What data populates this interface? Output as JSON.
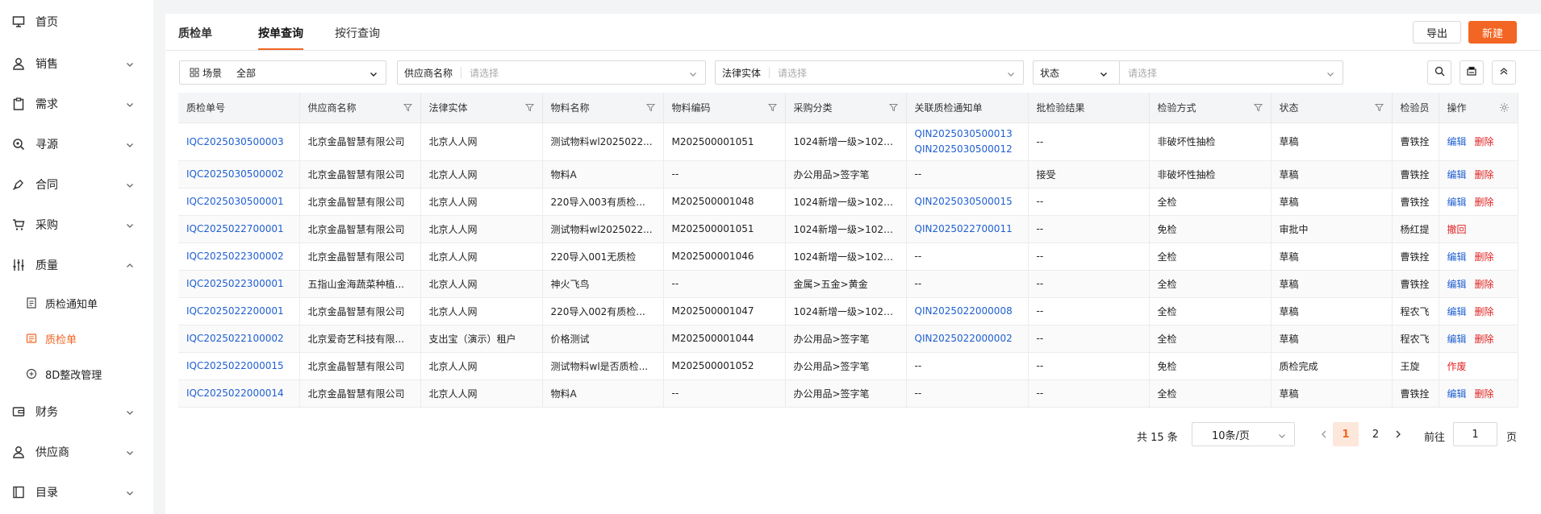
{
  "sidebar": {
    "items": [
      {
        "label": "首页",
        "icon": "monitor-icon",
        "chevron": false
      },
      {
        "label": "销售",
        "icon": "user-icon",
        "chevron": "down"
      },
      {
        "label": "需求",
        "icon": "clipboard-icon",
        "chevron": "down"
      },
      {
        "label": "寻源",
        "icon": "search-source-icon",
        "chevron": "down"
      },
      {
        "label": "合同",
        "icon": "pen-icon",
        "chevron": "down"
      },
      {
        "label": "采购",
        "icon": "cart-icon",
        "chevron": "down"
      },
      {
        "label": "质量",
        "icon": "sliders-icon",
        "chevron": "up"
      }
    ],
    "sub_items": [
      {
        "label": "质检通知单",
        "icon": "doc-icon",
        "active": false
      },
      {
        "label": "质检单",
        "icon": "list-doc-icon",
        "active": true
      },
      {
        "label": "8D整改管理",
        "icon": "8d-icon",
        "active": false
      }
    ],
    "items_after": [
      {
        "label": "财务",
        "icon": "wallet-icon",
        "chevron": "down"
      },
      {
        "label": "供应商",
        "icon": "user-icon",
        "chevron": "down"
      },
      {
        "label": "目录",
        "icon": "book-icon",
        "chevron": "down"
      }
    ]
  },
  "tabs": [
    {
      "label": "质检单"
    },
    {
      "label": "按单查询"
    },
    {
      "label": "按行查询"
    }
  ],
  "toolbar": {
    "export_label": "导出",
    "new_label": "新建"
  },
  "filters": {
    "scene_label": "场景",
    "scene_value": "全部",
    "supplier_label": "供应商名称",
    "supplier_placeholder": "请选择",
    "entity_label": "法律实体",
    "entity_placeholder": "请选择",
    "status_label": "状态",
    "status_placeholder": "请选择"
  },
  "table": {
    "headers": [
      "质检单号",
      "供应商名称",
      "法律实体",
      "物料名称",
      "物料编码",
      "采购分类",
      "关联质检通知单",
      "批检验结果",
      "检验方式",
      "状态",
      "检验员",
      "操作"
    ],
    "rows": [
      {
        "no": "IQC2025030500003",
        "supplier": "北京金晶智慧有限公司",
        "entity": "北京人人网",
        "material": "测试物料wl2025022...",
        "code": "M202500001051",
        "category": "1024新增一级>1024...",
        "notice": [
          "QIN2025030500013",
          "QIN2025030500012"
        ],
        "result": "--",
        "method": "非破坏性抽检",
        "status": "草稿",
        "inspector": "曹铁拴",
        "ops": [
          "编辑",
          "删除"
        ]
      },
      {
        "no": "IQC2025030500002",
        "supplier": "北京金晶智慧有限公司",
        "entity": "北京人人网",
        "material": "物料A",
        "code": "--",
        "category": "办公用品>签字笔",
        "notice": [],
        "notice_text": "--",
        "result": "接受",
        "method": "非破坏性抽检",
        "status": "草稿",
        "inspector": "曹铁拴",
        "ops": [
          "编辑",
          "删除"
        ]
      },
      {
        "no": "IQC2025030500001",
        "supplier": "北京金晶智慧有限公司",
        "entity": "北京人人网",
        "material": "220导入003有质检...",
        "code": "M202500001048",
        "category": "1024新增一级>1024...",
        "notice": [
          "QIN2025030500015"
        ],
        "result": "--",
        "method": "全检",
        "status": "草稿",
        "inspector": "曹铁拴",
        "ops": [
          "编辑",
          "删除"
        ]
      },
      {
        "no": "IQC2025022700001",
        "supplier": "北京金晶智慧有限公司",
        "entity": "北京人人网",
        "material": "测试物料wl2025022...",
        "code": "M202500001051",
        "category": "1024新增一级>1024...",
        "notice": [
          "QIN2025022700011"
        ],
        "result": "--",
        "method": "免检",
        "status": "审批中",
        "inspector": "杨红提",
        "ops": [
          "撤回"
        ]
      },
      {
        "no": "IQC2025022300002",
        "supplier": "北京金晶智慧有限公司",
        "entity": "北京人人网",
        "material": "220导入001无质检",
        "code": "M202500001046",
        "category": "1024新增一级>1024...",
        "notice": [],
        "notice_text": "--",
        "result": "--",
        "method": "全检",
        "status": "草稿",
        "inspector": "曹铁拴",
        "ops": [
          "编辑",
          "删除"
        ]
      },
      {
        "no": "IQC2025022300001",
        "supplier": "五指山金海蔬菜种植...",
        "entity": "北京人人网",
        "material": "神火飞鸟",
        "code": "--",
        "category": "金属>五金>黄金",
        "notice": [],
        "notice_text": "--",
        "result": "--",
        "method": "全检",
        "status": "草稿",
        "inspector": "曹铁拴",
        "ops": [
          "编辑",
          "删除"
        ]
      },
      {
        "no": "IQC2025022200001",
        "supplier": "北京金晶智慧有限公司",
        "entity": "北京人人网",
        "material": "220导入002有质检...",
        "code": "M202500001047",
        "category": "1024新增一级>1024...",
        "notice": [
          "QIN2025022000008"
        ],
        "result": "--",
        "method": "全检",
        "status": "草稿",
        "inspector": "程农飞",
        "ops": [
          "编辑",
          "删除"
        ]
      },
      {
        "no": "IQC2025022100002",
        "supplier": "北京爱奇艺科技有限...",
        "entity": "支出宝（演示）租户",
        "material": "价格测试",
        "code": "M202500001044",
        "category": "办公用品>签字笔",
        "notice": [
          "QIN2025022000002"
        ],
        "result": "--",
        "method": "全检",
        "status": "草稿",
        "inspector": "程农飞",
        "ops": [
          "编辑",
          "删除"
        ]
      },
      {
        "no": "IQC2025022000015",
        "supplier": "北京金晶智慧有限公司",
        "entity": "北京人人网",
        "material": "测试物料wl是否质检...",
        "code": "M202500001052",
        "category": "办公用品>签字笔",
        "notice": [],
        "notice_text": "--",
        "result": "--",
        "method": "免检",
        "status": "质检完成",
        "inspector": "王旋",
        "ops": [
          "作废"
        ]
      },
      {
        "no": "IQC2025022000014",
        "supplier": "北京金晶智慧有限公司",
        "entity": "北京人人网",
        "material": "物料A",
        "code": "--",
        "category": "办公用品>签字笔",
        "notice": [],
        "notice_text": "--",
        "result": "--",
        "method": "全检",
        "status": "草稿",
        "inspector": "曹铁拴",
        "ops": [
          "编辑",
          "删除"
        ]
      }
    ]
  },
  "pagination": {
    "total_text": "共 15 条",
    "page_size": "10条/页",
    "pages": [
      "1",
      "2"
    ],
    "current": "1",
    "goto_label": "前往",
    "goto_value": "1",
    "page_suffix": "页"
  },
  "colors": {
    "accent": "#f26522",
    "link": "#1f5fd1",
    "danger": "#e02020"
  }
}
